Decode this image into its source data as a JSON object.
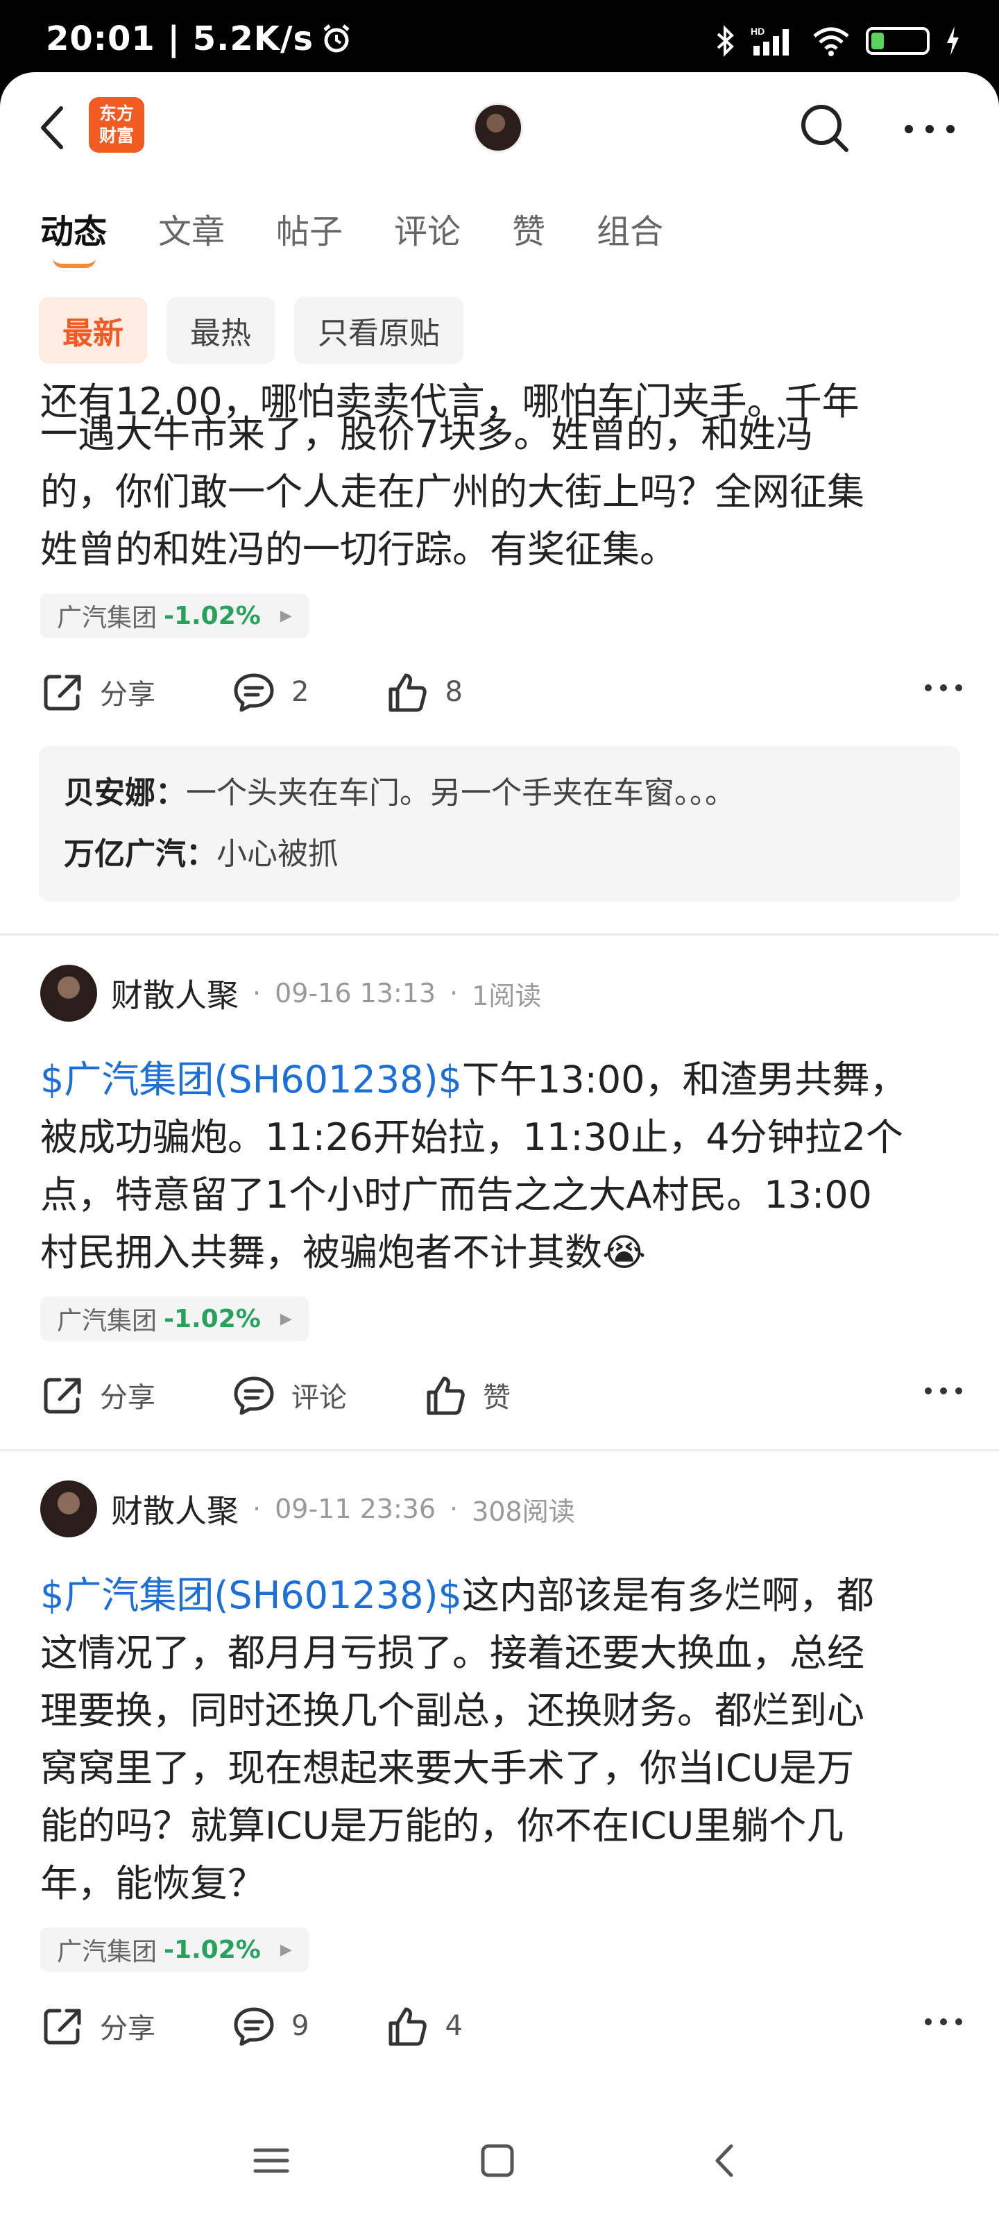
{
  "status_bar": {
    "time_speed": "20:01 | 5.2K/s",
    "battery": "21"
  },
  "nav": {
    "logo_line1": "东方",
    "logo_line2": "财富"
  },
  "tabs": [
    "动态",
    "文章",
    "帖子",
    "评论",
    "赞",
    "组合"
  ],
  "filters": [
    "最新",
    "最热",
    "只看原贴"
  ],
  "colors": {
    "accent": "#f15a22",
    "cashtag": "#1b6fd6",
    "stock_down": "#27a15c"
  },
  "posts": [
    {
      "cut_line": "还有12.00，哪怕卖卖代言，哪怕车门夹手。千年",
      "text_lines": [
        "一遇大牛市来了，股价7块多。姓曾的，和姓冯",
        "的，你们敢一个人走在广州的大街上吗？全网征集",
        "姓曾的和姓冯的一切行踪。有奖征集。"
      ],
      "stock": {
        "name": "广汽集团",
        "change": "-1.02%"
      },
      "share_label": "分享",
      "comment_count": "2",
      "like_count": "8",
      "comments": [
        {
          "author": "贝安娜：",
          "text": "一个头夹在车门。另一个手夹在车窗。。。"
        },
        {
          "author": "万亿广汽：",
          "text": "小心被抓"
        }
      ]
    },
    {
      "author": "财散人聚",
      "time": "09-16 13:13",
      "reads": "1阅读",
      "cashtag": "$广汽集团(SH601238)$",
      "first_rest": "下午13:00，和渣男共舞，",
      "text_lines": [
        "被成功骗炮。11:26开始拉，11:30止，4分钟拉2个",
        "点，特意留了1个小时广而告之之大A村民。13:00",
        "村民拥入共舞，被骗炮者不计其数😭"
      ],
      "stock": {
        "name": "广汽集团",
        "change": "-1.02%"
      },
      "share_label": "分享",
      "comment_label": "评论",
      "like_label": "赞"
    },
    {
      "author": "财散人聚",
      "time": "09-11 23:36",
      "reads": "308阅读",
      "cashtag": "$广汽集团(SH601238)$",
      "first_rest": "这内部该是有多烂啊，都",
      "text_lines": [
        "这情况了，都月月亏损了。接着还要大换血，总经",
        "理要换，同时还换几个副总，还换财务。都烂到心",
        "窝窝里了，现在想起来要大手术了，你当ICU是万",
        "能的吗？就算ICU是万能的，你不在ICU里躺个几",
        "年，能恢复？"
      ],
      "stock": {
        "name": "广汽集团",
        "change": "-1.02%"
      },
      "share_label": "分享",
      "comment_count": "9",
      "like_count": "4"
    }
  ]
}
